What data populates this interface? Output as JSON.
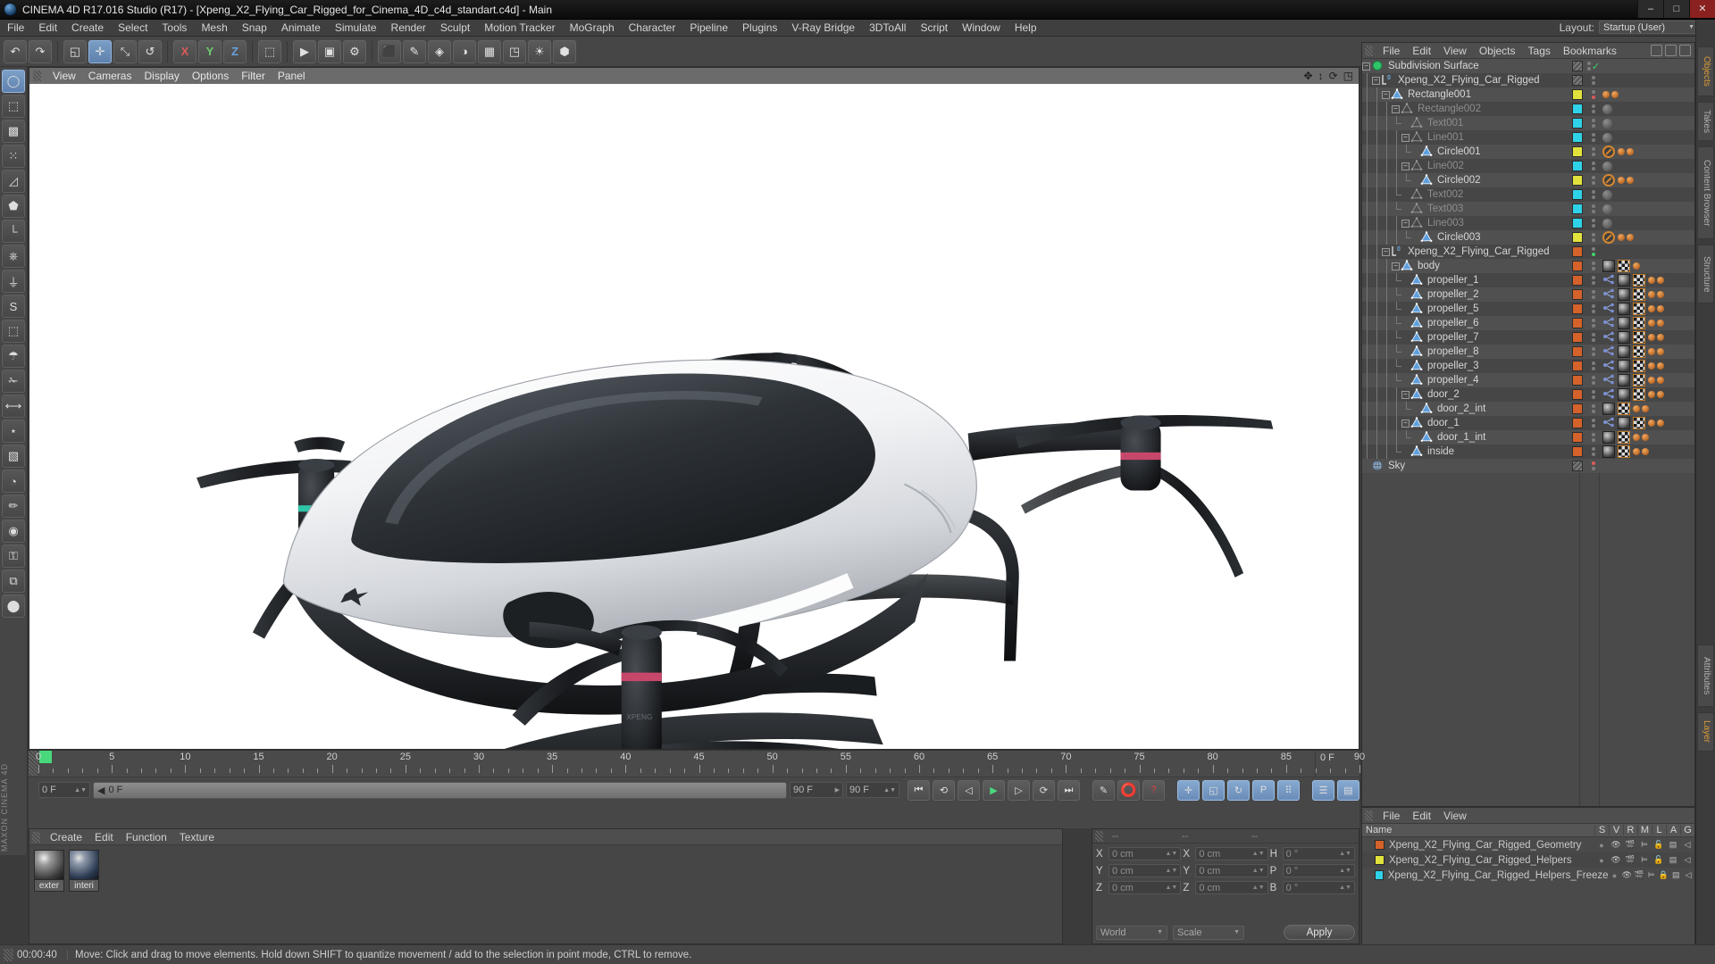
{
  "window": {
    "title": "CINEMA 4D R17.016 Studio (R17) - [Xpeng_X2_Flying_Car_Rigged_for_Cinema_4D_c4d_standart.c4d] - Main",
    "minimize": "–",
    "maximize": "□",
    "close": "✕"
  },
  "menubar": {
    "items": [
      "File",
      "Edit",
      "Create",
      "Select",
      "Tools",
      "Mesh",
      "Snap",
      "Animate",
      "Simulate",
      "Render",
      "Sculpt",
      "Motion Tracker",
      "MoGraph",
      "Character",
      "Pipeline",
      "Plugins",
      "V-Ray Bridge",
      "3DToAll",
      "Script",
      "Window",
      "Help"
    ],
    "layout_label": "Layout:",
    "layout_value": "Startup (User)"
  },
  "toolbar": {
    "row1": [
      {
        "name": "undo-button",
        "glyph": "↶"
      },
      {
        "name": "redo-button",
        "glyph": "↷"
      },
      {
        "name": "select-live-button",
        "glyph": "◱"
      },
      {
        "name": "move-tool-button",
        "glyph": "✛",
        "active": true
      },
      {
        "name": "scale-tool-button",
        "glyph": "⤡"
      },
      {
        "name": "rotate-tool-button",
        "glyph": "↺"
      },
      {
        "name": "axis-x-button",
        "glyph": "X",
        "axis": "x"
      },
      {
        "name": "axis-y-button",
        "glyph": "Y",
        "axis": "y"
      },
      {
        "name": "axis-z-button",
        "glyph": "Z",
        "axis": "z"
      },
      {
        "name": "world-coordinates-button",
        "glyph": "⬚"
      },
      {
        "name": "render-view-button",
        "glyph": "▶"
      },
      {
        "name": "render-region-button",
        "glyph": "▣"
      },
      {
        "name": "render-settings-button",
        "glyph": "⚙"
      },
      {
        "name": "cube-primitive-button",
        "glyph": "⬛"
      },
      {
        "name": "spline-pen-button",
        "glyph": "✎"
      },
      {
        "name": "generator-button",
        "glyph": "◈"
      },
      {
        "name": "deformer-button",
        "glyph": "◑"
      },
      {
        "name": "environment-button",
        "glyph": "▦"
      },
      {
        "name": "camera-button",
        "glyph": "◳"
      },
      {
        "name": "light-button",
        "glyph": "☀"
      },
      {
        "name": "mograph-button",
        "glyph": "⬢"
      }
    ]
  },
  "left_tools": [
    {
      "name": "live-selection-tool",
      "glyph": "◯"
    },
    {
      "name": "box-model-tool",
      "glyph": "⬚"
    },
    {
      "name": "texture-tool",
      "glyph": "▩"
    },
    {
      "name": "points-mode-tool",
      "glyph": "⁙"
    },
    {
      "name": "edges-mode-tool",
      "glyph": "◿"
    },
    {
      "name": "polygons-mode-tool",
      "glyph": "⬟"
    },
    {
      "name": "axis-mode-tool",
      "glyph": "└"
    },
    {
      "name": "enable-axis-tool",
      "glyph": "⎈"
    },
    {
      "name": "lock-axis-tool",
      "glyph": "⏚"
    },
    {
      "name": "snap-tool",
      "glyph": "S"
    },
    {
      "name": "workplane-tool",
      "glyph": "⬚"
    },
    {
      "name": "magnet-tool",
      "glyph": "☂"
    },
    {
      "name": "knife-tool",
      "glyph": "✁"
    },
    {
      "name": "measure-tool",
      "glyph": "⟷"
    },
    {
      "name": "uv-point-tool",
      "glyph": "⋆"
    },
    {
      "name": "uv-polygon-tool",
      "glyph": "▧"
    },
    {
      "name": "sculpt-brush-tool",
      "glyph": "◔"
    },
    {
      "name": "paint-tool",
      "glyph": "✏"
    },
    {
      "name": "weight-tool",
      "glyph": "◉"
    },
    {
      "name": "lock-tool",
      "glyph": "⚿"
    },
    {
      "name": "render-queue-tool",
      "glyph": "⧉"
    },
    {
      "name": "viewport-solo-tool",
      "glyph": "⬤"
    }
  ],
  "brand": "MAXON CINEMA 4D",
  "viewport": {
    "menu": [
      "View",
      "Cameras",
      "Display",
      "Options",
      "Filter",
      "Panel"
    ],
    "nav_icons": [
      "pan-icon",
      "dolly-icon",
      "rotate-icon",
      "maximize-view-icon"
    ]
  },
  "object_manager": {
    "menu": [
      "File",
      "Edit",
      "View",
      "Objects",
      "Tags",
      "Bookmarks"
    ],
    "rows": [
      {
        "name": "Subdivision Surface",
        "indent": 0,
        "icon": "subdivision-surface",
        "expander": "−",
        "dim": false,
        "chip": "hatch",
        "dots": [
          "grey"
        ],
        "check": true,
        "tags": []
      },
      {
        "name": "Xpeng_X2_Flying_Car_Rigged",
        "indent": 1,
        "icon": "layer-zero",
        "expander": "−",
        "dim": false,
        "chip": "hatch",
        "dots": [
          "grey"
        ],
        "tags": []
      },
      {
        "name": "Rectangle001",
        "indent": 2,
        "icon": "polygon-object",
        "expander": "−",
        "dim": false,
        "chip": "#e2e23c",
        "dots": [
          "grey",
          "red"
        ],
        "tags": [
          "dot-orange",
          "dot-orange"
        ]
      },
      {
        "name": "Rectangle002",
        "indent": 3,
        "icon": "polygon-object-dim",
        "expander": "−",
        "dim": true,
        "chip": "#2fd3e8",
        "dots": [
          "grey"
        ],
        "tags": [
          "greyball"
        ]
      },
      {
        "name": "Text001",
        "indent": 4,
        "icon": "polygon-object-dim",
        "expander": "",
        "dim": true,
        "chip": "#2fd3e8",
        "dots": [
          "grey"
        ],
        "tags": [
          "greyball"
        ]
      },
      {
        "name": "Line001",
        "indent": 4,
        "icon": "polygon-object-dim",
        "expander": "−",
        "dim": true,
        "chip": "#2fd3e8",
        "dots": [
          "grey"
        ],
        "tags": [
          "greyball"
        ]
      },
      {
        "name": "Circle001",
        "indent": 5,
        "icon": "polygon-object",
        "expander": "",
        "dim": false,
        "chip": "#e2e23c",
        "dots": [
          "grey"
        ],
        "tags": [
          "noentry",
          "dot-orange",
          "dot-orange"
        ]
      },
      {
        "name": "Line002",
        "indent": 4,
        "icon": "polygon-object-dim",
        "expander": "−",
        "dim": true,
        "chip": "#2fd3e8",
        "dots": [
          "grey"
        ],
        "tags": [
          "greyball"
        ]
      },
      {
        "name": "Circle002",
        "indent": 5,
        "icon": "polygon-object",
        "expander": "",
        "dim": false,
        "chip": "#e2e23c",
        "dots": [
          "grey"
        ],
        "tags": [
          "noentry",
          "dot-orange",
          "dot-orange"
        ]
      },
      {
        "name": "Text002",
        "indent": 4,
        "icon": "polygon-object-dim",
        "expander": "",
        "dim": true,
        "chip": "#2fd3e8",
        "dots": [
          "grey"
        ],
        "tags": [
          "greyball"
        ]
      },
      {
        "name": "Text003",
        "indent": 4,
        "icon": "polygon-object-dim",
        "expander": "",
        "dim": true,
        "chip": "#2fd3e8",
        "dots": [
          "grey"
        ],
        "tags": [
          "greyball"
        ]
      },
      {
        "name": "Line003",
        "indent": 4,
        "icon": "polygon-object-dim",
        "expander": "−",
        "dim": true,
        "chip": "#2fd3e8",
        "dots": [
          "grey"
        ],
        "tags": [
          "greyball"
        ]
      },
      {
        "name": "Circle003",
        "indent": 5,
        "icon": "polygon-object",
        "expander": "",
        "dim": false,
        "chip": "#e2e23c",
        "dots": [
          "grey"
        ],
        "tags": [
          "noentry",
          "dot-orange",
          "dot-orange"
        ]
      },
      {
        "name": "Xpeng_X2_Flying_Car_Rigged",
        "indent": 2,
        "icon": "layer-zero",
        "expander": "−",
        "dim": false,
        "chip": "#d4622a",
        "dots": [
          "grey",
          "green"
        ],
        "tags": []
      },
      {
        "name": "body",
        "indent": 3,
        "icon": "polygon-object",
        "expander": "−",
        "dim": false,
        "chip": "#d4622a",
        "dots": [
          "grey"
        ],
        "tags": [
          "mat",
          "checker",
          "dot-orange"
        ]
      },
      {
        "name": "propeller_1",
        "indent": 4,
        "icon": "polygon-object",
        "expander": "",
        "dim": false,
        "chip": "#d4622a",
        "dots": [
          "grey"
        ],
        "tags": [
          "xpresso",
          "mat",
          "checker",
          "dot-orange",
          "dot-orange"
        ]
      },
      {
        "name": "propeller_2",
        "indent": 4,
        "icon": "polygon-object",
        "expander": "",
        "dim": false,
        "chip": "#d4622a",
        "dots": [
          "grey"
        ],
        "tags": [
          "xpresso",
          "mat",
          "checker",
          "dot-orange",
          "dot-orange"
        ]
      },
      {
        "name": "propeller_5",
        "indent": 4,
        "icon": "polygon-object",
        "expander": "",
        "dim": false,
        "chip": "#d4622a",
        "dots": [
          "grey"
        ],
        "tags": [
          "xpresso",
          "mat",
          "checker",
          "dot-orange",
          "dot-orange"
        ]
      },
      {
        "name": "propeller_6",
        "indent": 4,
        "icon": "polygon-object",
        "expander": "",
        "dim": false,
        "chip": "#d4622a",
        "dots": [
          "grey"
        ],
        "tags": [
          "xpresso",
          "mat",
          "checker",
          "dot-orange",
          "dot-orange"
        ]
      },
      {
        "name": "propeller_7",
        "indent": 4,
        "icon": "polygon-object",
        "expander": "",
        "dim": false,
        "chip": "#d4622a",
        "dots": [
          "grey"
        ],
        "tags": [
          "xpresso",
          "mat",
          "checker",
          "dot-orange",
          "dot-orange"
        ]
      },
      {
        "name": "propeller_8",
        "indent": 4,
        "icon": "polygon-object",
        "expander": "",
        "dim": false,
        "chip": "#d4622a",
        "dots": [
          "grey"
        ],
        "tags": [
          "xpresso",
          "mat",
          "checker",
          "dot-orange",
          "dot-orange"
        ]
      },
      {
        "name": "propeller_3",
        "indent": 4,
        "icon": "polygon-object",
        "expander": "",
        "dim": false,
        "chip": "#d4622a",
        "dots": [
          "grey"
        ],
        "tags": [
          "xpresso",
          "mat",
          "checker",
          "dot-orange",
          "dot-orange"
        ]
      },
      {
        "name": "propeller_4",
        "indent": 4,
        "icon": "polygon-object",
        "expander": "",
        "dim": false,
        "chip": "#d4622a",
        "dots": [
          "grey"
        ],
        "tags": [
          "xpresso",
          "mat",
          "checker",
          "dot-orange",
          "dot-orange"
        ]
      },
      {
        "name": "door_2",
        "indent": 4,
        "icon": "polygon-object",
        "expander": "−",
        "dim": false,
        "chip": "#d4622a",
        "dots": [
          "grey"
        ],
        "tags": [
          "xpresso",
          "mat",
          "checker",
          "dot-orange",
          "dot-orange"
        ]
      },
      {
        "name": "door_2_int",
        "indent": 5,
        "icon": "polygon-object",
        "expander": "",
        "dim": false,
        "chip": "#d4622a",
        "dots": [
          "grey"
        ],
        "tags": [
          "mat",
          "checker",
          "dot-orange",
          "dot-orange"
        ]
      },
      {
        "name": "door_1",
        "indent": 4,
        "icon": "polygon-object",
        "expander": "−",
        "dim": false,
        "chip": "#d4622a",
        "dots": [
          "grey"
        ],
        "tags": [
          "xpresso",
          "mat",
          "checker",
          "dot-orange",
          "dot-orange"
        ]
      },
      {
        "name": "door_1_int",
        "indent": 5,
        "icon": "polygon-object",
        "expander": "",
        "dim": false,
        "chip": "#d4622a",
        "dots": [
          "grey"
        ],
        "tags": [
          "mat",
          "checker",
          "dot-orange",
          "dot-orange"
        ]
      },
      {
        "name": "inside",
        "indent": 4,
        "icon": "polygon-object",
        "expander": "",
        "dim": false,
        "chip": "#d4622a",
        "dots": [
          "grey"
        ],
        "tags": [
          "mat",
          "checker",
          "dot-orange",
          "dot-orange"
        ]
      },
      {
        "name": "Sky",
        "indent": 0,
        "icon": "sky-object",
        "expander": "",
        "dim": false,
        "chip": "hatch",
        "dots": [
          "red",
          "grey"
        ],
        "tags": []
      }
    ]
  },
  "layer_manager": {
    "menu": [
      "File",
      "Edit",
      "View"
    ],
    "columns": [
      "Name",
      "S",
      "V",
      "R",
      "M",
      "L",
      "A",
      "G"
    ],
    "rows": [
      {
        "name": "Xpeng_X2_Flying_Car_Rigged_Geometry",
        "color": "#d4622a",
        "locked": false
      },
      {
        "name": "Xpeng_X2_Flying_Car_Rigged_Helpers",
        "color": "#e2e23c",
        "locked": false
      },
      {
        "name": "Xpeng_X2_Flying_Car_Rigged_Helpers_Freeze",
        "color": "#2fd3e8",
        "locked": true
      }
    ]
  },
  "timeline": {
    "ticks": [
      0,
      5,
      10,
      15,
      20,
      25,
      30,
      35,
      40,
      45,
      50,
      55,
      60,
      65,
      70,
      75,
      80,
      85,
      90
    ],
    "min_frame": 0,
    "max_frame": 90,
    "current_frame_field": "0 F",
    "current_frame_readout": "0 F",
    "range_start": "0 F",
    "range_end": "90 F",
    "range_end2": "90 F",
    "slider_value": "0 F",
    "transport": [
      {
        "name": "go-to-start-button",
        "glyph": "⏮"
      },
      {
        "name": "previous-key-button",
        "glyph": "⟲"
      },
      {
        "name": "step-back-button",
        "glyph": "◁"
      },
      {
        "name": "play-button",
        "glyph": "▶"
      },
      {
        "name": "step-forward-button",
        "glyph": "▷"
      },
      {
        "name": "next-key-button",
        "glyph": "⟳"
      },
      {
        "name": "go-to-end-button",
        "glyph": "⏭"
      }
    ],
    "record_group": [
      {
        "name": "autokey-button",
        "glyph": "✎"
      },
      {
        "name": "record-active-objects-button",
        "glyph": "⭕"
      },
      {
        "name": "keyframe-selection-button",
        "glyph": "?"
      }
    ],
    "key_toggles": [
      {
        "name": "record-position-button",
        "glyph": "✛",
        "on": true
      },
      {
        "name": "record-scale-button",
        "glyph": "◱",
        "on": true
      },
      {
        "name": "record-rotation-button",
        "glyph": "↻",
        "on": true
      },
      {
        "name": "record-pla-button",
        "glyph": "P",
        "on": true
      },
      {
        "name": "record-parameter-button",
        "glyph": "⠿",
        "on": true
      }
    ],
    "extras": [
      {
        "name": "timeline-toggle-button",
        "glyph": "☰"
      },
      {
        "name": "animation-mode-button",
        "glyph": "▤"
      }
    ]
  },
  "material_manager": {
    "menu": [
      "Create",
      "Edit",
      "Function",
      "Texture"
    ],
    "materials": [
      {
        "name": "exter",
        "style": "grey"
      },
      {
        "name": "interi",
        "style": "blue"
      }
    ]
  },
  "coordinates": {
    "headers": [
      "--",
      "--",
      "--"
    ],
    "position": {
      "label_x": "X",
      "label_y": "Y",
      "label_z": "Z",
      "x": "0 cm",
      "y": "0 cm",
      "z": "0 cm"
    },
    "size": {
      "label_x": "X",
      "label_y": "Y",
      "label_z": "Z",
      "x": "0 cm",
      "y": "0 cm",
      "z": "0 cm"
    },
    "rotation": {
      "label_h": "H",
      "label_p": "P",
      "label_b": "B",
      "h": "0 °",
      "p": "0 °",
      "b": "0 °"
    },
    "system": "World",
    "mode": "Scale",
    "apply": "Apply"
  },
  "statusbar": {
    "time": "00:00:40",
    "message": "Move: Click and drag to move elements. Hold down SHIFT to quantize movement / add to the selection in point mode, CTRL to remove."
  },
  "side_tabs": [
    {
      "label": "Objects",
      "amber": true
    },
    {
      "label": "Takes",
      "amber": false
    },
    {
      "label": "Content Browser",
      "amber": false
    },
    {
      "label": "Structure",
      "amber": false
    },
    {
      "label": "Attributes",
      "amber": false
    },
    {
      "label": "Layer",
      "amber": true
    }
  ],
  "colors": {
    "panel_bg": "#464646",
    "tree_bg": "#4a4a4a",
    "accent_orange": "#d4622a",
    "accent_yellow": "#e2e23c",
    "accent_cyan": "#2fd3e8",
    "play_green": "#49d97c",
    "record_red": "#e04040"
  }
}
